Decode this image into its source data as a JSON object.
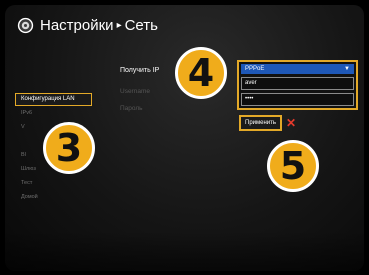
{
  "header": {
    "title": "Настройки",
    "separator": "▸",
    "section": "Сеть"
  },
  "sidebar": {
    "items": [
      {
        "label": "Конфигурация LAN",
        "active": true
      },
      {
        "label": "IPv6",
        "active": false
      },
      {
        "label": "V",
        "active": false
      },
      {
        "label": "",
        "active": false
      },
      {
        "label": "Bl",
        "active": false
      },
      {
        "label": "Шлюз",
        "active": false
      },
      {
        "label": "Тест",
        "active": false
      },
      {
        "label": "Домой",
        "active": false
      }
    ]
  },
  "form": {
    "get_ip_label": "Получить IP",
    "username_label": "Username",
    "password_label": "Пароль",
    "mode_value": "PPPoE",
    "username_value": "aver",
    "password_value": "••••",
    "apply_label": "Применить",
    "cancel_symbol": "✕"
  },
  "badges": {
    "step3": "3",
    "step4": "4",
    "step5": "5"
  },
  "colors": {
    "accent": "#e3a928",
    "dropdown": "#1e58b8",
    "cancel": "#e53a2c",
    "badge": "#f0ac1b"
  }
}
